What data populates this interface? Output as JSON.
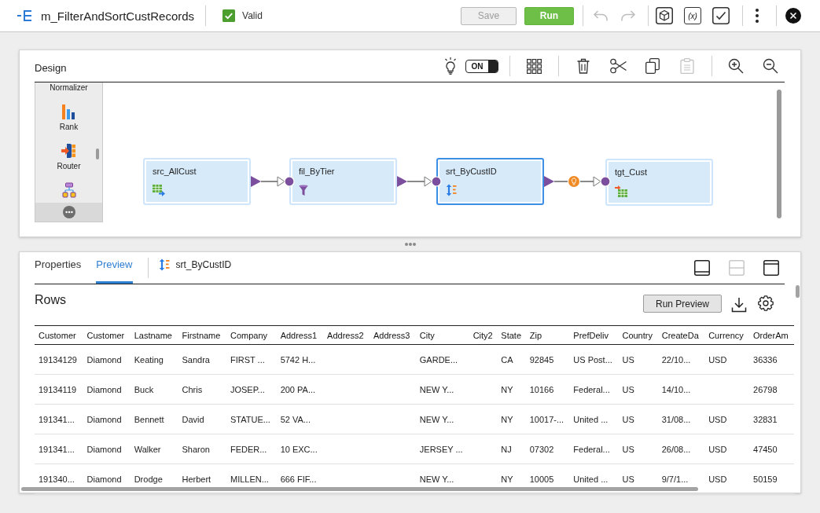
{
  "header": {
    "title": "m_FilterAndSortCustRecords",
    "status": {
      "label": "Valid",
      "checked": true
    },
    "buttons": [
      {
        "label": "Save",
        "kind": "secondary",
        "disabled": true
      },
      {
        "label": "Run",
        "kind": "primary",
        "disabled": false
      }
    ],
    "undo": {
      "disabled": true
    },
    "redo": {
      "disabled": true
    },
    "expression_button": {
      "label": "(x)"
    }
  },
  "design": {
    "title": "Design",
    "toggle": {
      "label": "ON",
      "on": true
    },
    "paste": {
      "disabled": true
    },
    "palette": {
      "items": [
        {
          "kind": "plain",
          "label": "Normalizer"
        },
        {
          "kind": "rank",
          "label": "Rank"
        },
        {
          "kind": "router",
          "label": "Router"
        },
        {
          "kind": "hierarchy"
        }
      ]
    },
    "nodes": [
      {
        "label": "src_AllCust",
        "kind": "source",
        "selected": false
      },
      {
        "label": "fil_ByTier",
        "kind": "filter",
        "selected": false
      },
      {
        "label": "srt_ByCustID",
        "kind": "sorter",
        "selected": true
      },
      {
        "label": "tgt_Cust",
        "kind": "target",
        "selected": false
      }
    ],
    "links": [
      {
        "hint": false
      },
      {
        "hint": false
      },
      {
        "hint": true
      }
    ]
  },
  "panel": {
    "tabs": [
      {
        "label": "Properties",
        "selected": false
      },
      {
        "label": "Preview",
        "selected": true
      }
    ],
    "object_label": "srt_ByCustID",
    "layout_buttons": [
      {
        "disabled": false
      },
      {
        "disabled": true
      },
      {
        "disabled": false
      }
    ],
    "section_title": "Rows",
    "run_preview": {
      "label": "Run Preview"
    },
    "table": {
      "columns": [
        "Customer",
        "Customer",
        "Lastname",
        "Firstname",
        "Company",
        "Address1",
        "Address2",
        "Address3",
        "City",
        "City2",
        "State",
        "Zip",
        "PrefDeliv",
        "Country",
        "CreateDa",
        "Currency",
        "OrderAm"
      ],
      "rows": [
        [
          "19134129",
          "Diamond",
          "Keating",
          "Sandra",
          "FIRST ...",
          "5742 H...",
          null,
          null,
          "GARDE...",
          null,
          "CA",
          "92845",
          "US Post...",
          "US",
          "22/10...",
          "USD",
          "36336"
        ],
        [
          "19134119",
          "Diamond",
          "Buck",
          "Chris",
          "JOSEP...",
          "200 PA...",
          null,
          null,
          "NEW Y...",
          null,
          "NY",
          "10166",
          "Federal...",
          "US",
          "14/10...",
          null,
          "26798"
        ],
        [
          "191341...",
          "Diamond",
          "Bennett",
          "David",
          "STATUE...",
          "52 VA...",
          null,
          null,
          "NEW Y...",
          null,
          "NY",
          "10017-...",
          "United ...",
          "US",
          "31/08...",
          "USD",
          "32831"
        ],
        [
          "191341...",
          "Diamond",
          "Walker",
          "Sharon",
          "FEDER...",
          "10 EXC...",
          null,
          null,
          "JERSEY ...",
          null,
          "NJ",
          "07302",
          "Federal...",
          "US",
          "26/08...",
          "USD",
          "47450"
        ],
        [
          "191340...",
          "Diamond",
          "Drodge",
          "Herbert",
          "MILLEN...",
          "666 FIF...",
          null,
          null,
          "NEW Y...",
          null,
          "NY",
          "10005",
          "United ...",
          "US",
          "9/7/1...",
          "USD",
          "50159"
        ]
      ]
    }
  }
}
